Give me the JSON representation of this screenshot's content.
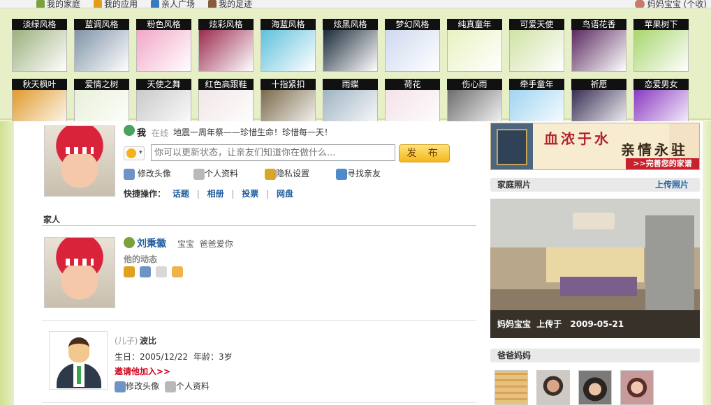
{
  "topbar": {
    "nav": [
      {
        "label": "我的家庭",
        "icon": "home-icon",
        "color": "#7aa23a"
      },
      {
        "label": "我的应用",
        "icon": "apps-icon",
        "color": "#e39b1b"
      },
      {
        "label": "亲人广场",
        "icon": "square-icon",
        "color": "#3b78c2"
      },
      {
        "label": "我的足迹",
        "icon": "footprint-icon",
        "color": "#8a5a3c"
      }
    ],
    "user_label": "妈妈宝宝 (个收)"
  },
  "skins": [
    {
      "label": "淡绿风格",
      "bg": "#9bb07c"
    },
    {
      "label": "蓝调风格",
      "bg": "#7f93a7"
    },
    {
      "label": "粉色风格",
      "bg": "#f2a6c6"
    },
    {
      "label": "炫彩风格",
      "bg": "#9a2b4f"
    },
    {
      "label": "海蓝风格",
      "bg": "#5ec0dd"
    },
    {
      "label": "炫黑风格",
      "bg": "#1b2a3a"
    },
    {
      "label": "梦幻风格",
      "bg": "#cfd8f0"
    },
    {
      "label": "纯真童年",
      "bg": "#e8f2c0"
    },
    {
      "label": "可爱天使",
      "bg": "#cfe2a4"
    },
    {
      "label": "鸟语花香",
      "bg": "#5a2a5f"
    },
    {
      "label": "苹果树下",
      "bg": "#a8d56c"
    },
    {
      "label": "秋天枫叶",
      "bg": "#e09a2c"
    },
    {
      "label": "爱情之树",
      "bg": "#e8f0d8"
    },
    {
      "label": "天使之舞",
      "bg": "#c9c9c9"
    },
    {
      "label": "红色高跟鞋",
      "bg": "#f1e7e7"
    },
    {
      "label": "十指紧扣",
      "bg": "#7a6a4a"
    },
    {
      "label": "雨蝶",
      "bg": "#9fb3c2"
    },
    {
      "label": "荷花",
      "bg": "#f4e2e8"
    },
    {
      "label": "伤心雨",
      "bg": "#6d6d6d"
    },
    {
      "label": "牵手童年",
      "bg": "#9fd4f2"
    },
    {
      "label": "祈愿",
      "bg": "#3a2f55"
    },
    {
      "label": "恋爱男女",
      "bg": "#8a3ac2"
    }
  ],
  "me": {
    "name": "我",
    "online": "在线",
    "status": "地震一周年祭——珍惜生命！珍惜每一天！",
    "input_placeholder": "你可以更新状态，让亲友们知道你在做什么...",
    "publish": "发 布",
    "actions": [
      "修改头像",
      "个人资料",
      "隐私设置",
      "寻找亲友"
    ],
    "quick_label": "快捷操作：",
    "quick_links": [
      "话题",
      "相册",
      "投票",
      "网盘"
    ]
  },
  "family": {
    "title": "家人",
    "members": [
      {
        "name": "刘秉徽",
        "tags": "宝宝  爸爸爱你",
        "activity": "他的动态"
      }
    ],
    "child": {
      "relation": "(儿子)",
      "name": "波比",
      "birthday_label": "生日：",
      "birthday": "2005/12/22",
      "age_label": "年龄：",
      "age": "3岁",
      "invite": "邀请他加入>>",
      "actions": [
        "修改头像",
        "个人资料"
      ]
    }
  },
  "side": {
    "banner": {
      "title": "血浓于水",
      "subtitle": "亲情永驻",
      "link": ">>完善您的家谱"
    },
    "photos": {
      "title": "家庭照片",
      "upload": "上传照片",
      "caption_user": "妈妈宝宝",
      "caption_mid": "上传于",
      "caption_date": "2009-05-21"
    },
    "parents": {
      "title": "爸爸妈妈"
    }
  },
  "colors": {
    "accent_blue": "#1f5e9e",
    "invite_red": "#d0021b",
    "skin_bg": "#e7efc7"
  }
}
